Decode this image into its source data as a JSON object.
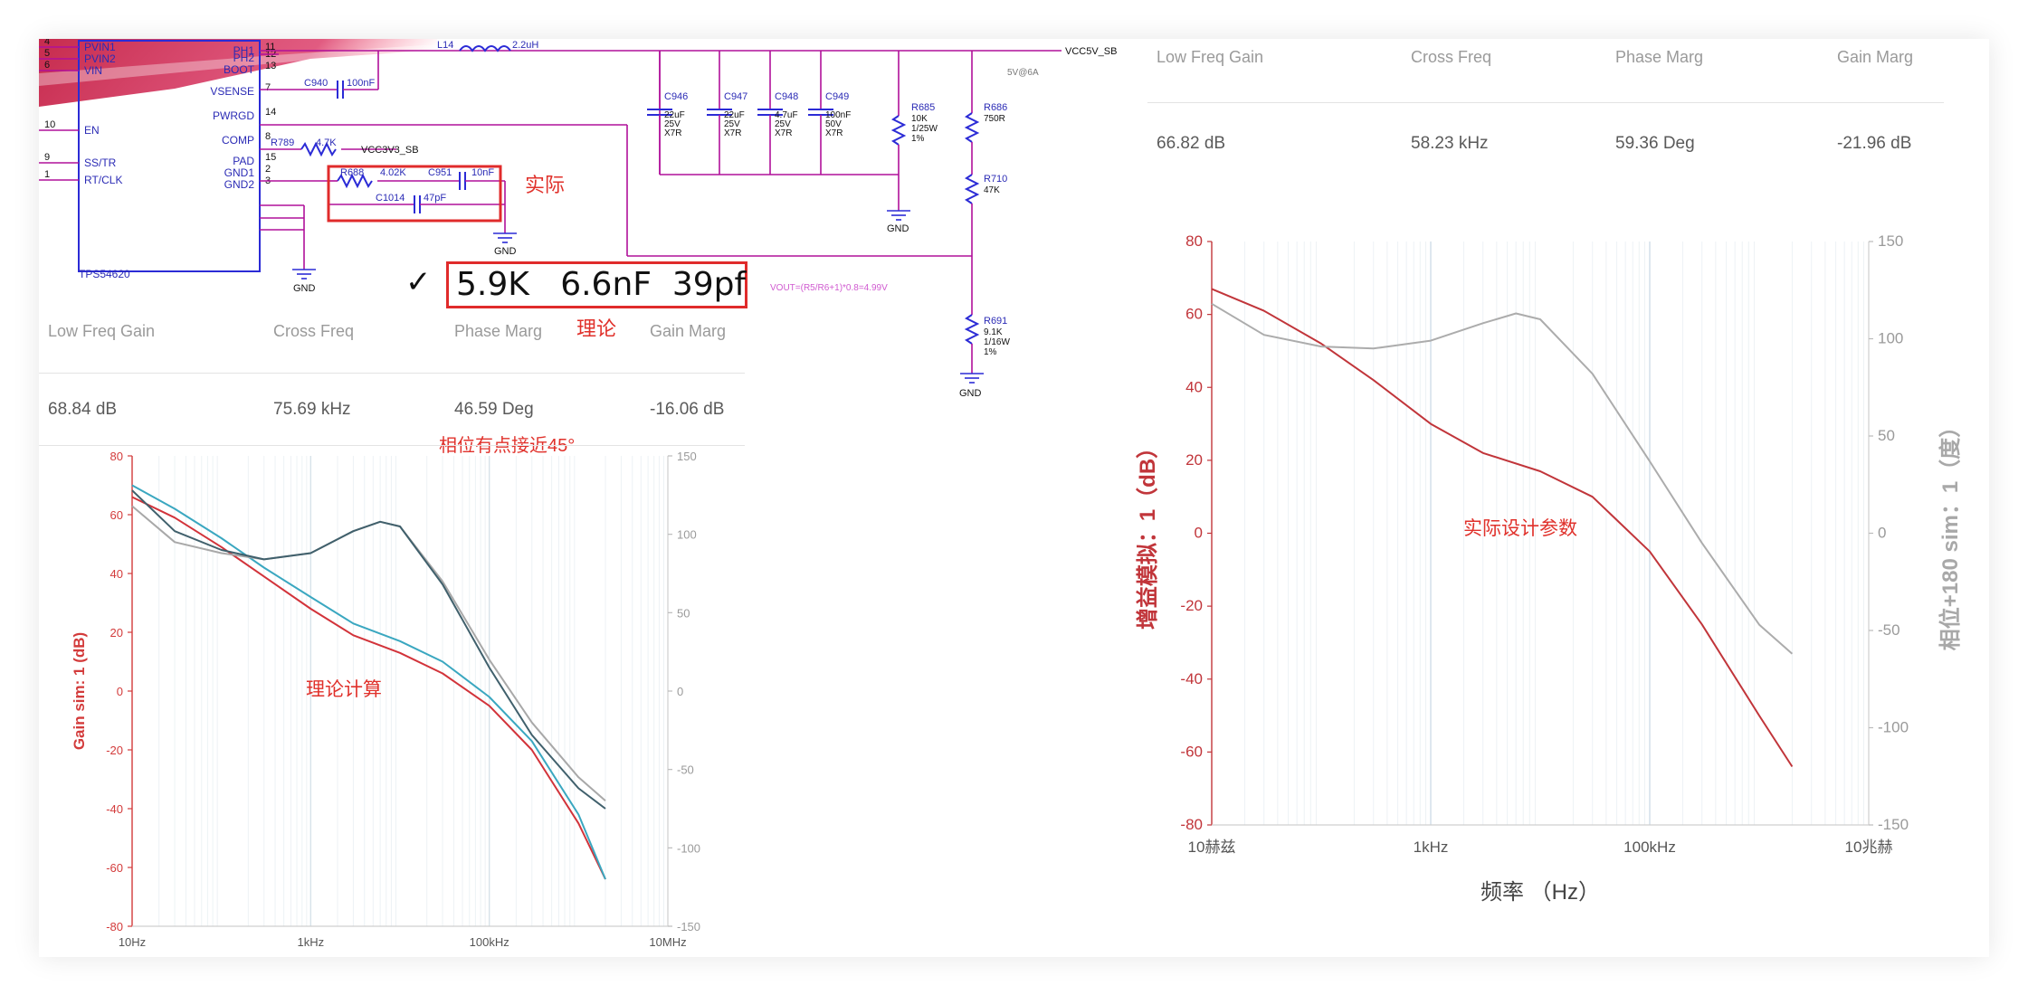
{
  "schematic": {
    "ic_name": "TPS54620",
    "pins_left": [
      {
        "num": "4",
        "name": "PVIN1"
      },
      {
        "num": "5",
        "name": "PVIN2"
      },
      {
        "num": "6",
        "name": "VIN"
      },
      {
        "num": "10",
        "name": "EN"
      },
      {
        "num": "9",
        "name": "SS/TR"
      },
      {
        "num": "1",
        "name": "RT/CLK"
      }
    ],
    "pins_right": [
      {
        "num": "11",
        "name": "PH1"
      },
      {
        "num": "12",
        "name": "PH2"
      },
      {
        "num": "13",
        "name": "BOOT"
      },
      {
        "num": "7",
        "name": "VSENSE"
      },
      {
        "num": "14",
        "name": "PWRGD"
      },
      {
        "num": "8",
        "name": "COMP"
      },
      {
        "num": "15",
        "name": "PAD"
      },
      {
        "num": "2",
        "name": "GND1"
      },
      {
        "num": "3",
        "name": "GND2"
      }
    ],
    "inductor": {
      "ref": "L14",
      "value": "2.2uH"
    },
    "c940": {
      "ref": "C940",
      "value": "100nF"
    },
    "r789": {
      "ref": "R789",
      "value": "4.7K"
    },
    "vcc3v3": "VCC3V3_SB",
    "vcc5v": "VCC5V_SB",
    "rail_note": "5V@6A",
    "r688": {
      "ref": "R688",
      "value": "4.02K"
    },
    "c951": {
      "ref": "C951",
      "value": "10nF"
    },
    "c1014": {
      "ref": "C1014",
      "value": "47pF"
    },
    "caps": [
      {
        "ref": "C946",
        "lines": [
          "22uF",
          "25V",
          "X7R"
        ]
      },
      {
        "ref": "C947",
        "lines": [
          "22uF",
          "25V",
          "X7R"
        ]
      },
      {
        "ref": "C948",
        "lines": [
          "4.7uF",
          "25V",
          "X7R"
        ]
      },
      {
        "ref": "C949",
        "lines": [
          "100nF",
          "50V",
          "X7R"
        ]
      }
    ],
    "r685": {
      "ref": "R685",
      "lines": [
        "10K",
        "1/25W",
        "1%"
      ]
    },
    "r686": {
      "ref": "R686",
      "lines": [
        "750R"
      ]
    },
    "r710": {
      "ref": "R710",
      "lines": [
        "47K"
      ]
    },
    "r691": {
      "ref": "R691",
      "lines": [
        "9.1K",
        "1/16W",
        "1%"
      ]
    },
    "gnd": "GND",
    "vout_formula": "VOUT=(R5/R6+1)*0.8=4.99V"
  },
  "annotations": {
    "actual": "实际",
    "check": "✓",
    "theory_values": "5.9K   6.6nF  39pf",
    "theory": "理论",
    "phase_note": "相位有点接近45°",
    "theory_calc": "理论计算",
    "actual_design": "实际设计参数"
  },
  "stats_left": {
    "headers": [
      "Low Freq Gain",
      "Cross Freq",
      "Phase Marg",
      "Gain Marg"
    ],
    "values": [
      "68.84 dB",
      "75.69 kHz",
      "46.59 Deg",
      "-16.06 dB"
    ]
  },
  "stats_right": {
    "headers": [
      "Low Freq Gain",
      "Cross Freq",
      "Phase Marg",
      "Gain Marg"
    ],
    "values": [
      "66.82 dB",
      "58.23 kHz",
      "59.36 Deg",
      "-21.96 dB"
    ]
  },
  "chart_data": [
    {
      "type": "line",
      "title": "",
      "xlabel": "",
      "ylabel": "Gain sim: 1 (dB)",
      "y2label": "",
      "x_scale": "log",
      "xlim": [
        10,
        10000000
      ],
      "ylim": [
        -80,
        80
      ],
      "y2lim": [
        -150,
        150
      ],
      "x_ticks": [
        {
          "v": 10,
          "label": "10Hz"
        },
        {
          "v": 1000,
          "label": "1kHz"
        },
        {
          "v": 100000,
          "label": "100kHz"
        },
        {
          "v": 10000000,
          "label": "10MHz"
        }
      ],
      "y_ticks": [
        "80",
        "60",
        "40",
        "20",
        "0",
        "-20",
        "-40",
        "-60",
        "-80"
      ],
      "y2_ticks": [
        "150",
        "100",
        "50",
        "0",
        "-50",
        "-100",
        "-150"
      ],
      "colors": {
        "gain": "#d2333a",
        "phase": "#a8a8a8",
        "teal": "#3aa7c0",
        "dark": "#40606c",
        "axis_left": "#d33b3b",
        "grid": "#d7e3ea"
      },
      "series": [
        {
          "axis": "left",
          "color": "#d2333a",
          "x": [
            10,
            30,
            100,
            300,
            1000,
            3000,
            10000,
            30000,
            100000,
            300000,
            1000000,
            2000000
          ],
          "y": [
            66,
            59,
            49,
            39,
            28,
            19,
            13,
            6,
            -5,
            -20,
            -45,
            -64
          ]
        },
        {
          "axis": "left",
          "color": "#3aa7c0",
          "x": [
            10,
            30,
            100,
            300,
            1000,
            3000,
            10000,
            30000,
            100000,
            300000,
            1000000,
            2000000
          ],
          "y": [
            70,
            62,
            52,
            42,
            32,
            23,
            17,
            10,
            -2,
            -17,
            -42,
            -64
          ]
        },
        {
          "axis": "right",
          "color": "#a8a8a8",
          "x": [
            10,
            30,
            100,
            300,
            1000,
            3000,
            6000,
            10000,
            30000,
            100000,
            300000,
            1000000,
            2000000
          ],
          "y": [
            118,
            95,
            88,
            84,
            88,
            102,
            108,
            105,
            70,
            20,
            -20,
            -55,
            -70
          ]
        },
        {
          "axis": "right",
          "color": "#40606c",
          "x": [
            10,
            30,
            100,
            300,
            1000,
            3000,
            6000,
            10000,
            30000,
            100000,
            300000,
            1000000,
            2000000
          ],
          "y": [
            128,
            102,
            90,
            84,
            88,
            102,
            108,
            105,
            68,
            15,
            -28,
            -62,
            -75
          ]
        }
      ]
    },
    {
      "type": "line",
      "title": "",
      "xlabel": "频率 （Hz）",
      "ylabel": "增益模拟：1（dB）",
      "y2label": "相位+180 sim：1（度）",
      "x_scale": "log",
      "xlim": [
        10,
        10000000
      ],
      "ylim": [
        -80,
        80
      ],
      "y2lim": [
        -150,
        150
      ],
      "x_ticks": [
        {
          "v": 10,
          "label": "10赫兹"
        },
        {
          "v": 1000,
          "label": "1kHz"
        },
        {
          "v": 100000,
          "label": "100kHz"
        },
        {
          "v": 10000000,
          "label": "10兆赫"
        }
      ],
      "y_ticks": [
        "80",
        "60",
        "40",
        "20",
        "0",
        "-20",
        "-40",
        "-60",
        "-80"
      ],
      "y2_ticks": [
        "150",
        "100",
        "50",
        "0",
        "-50",
        "-100",
        "-150"
      ],
      "colors": {
        "gain": "#c1353a",
        "phase": "#acacac",
        "axis_left": "#c1353a",
        "grid": "#cfdde8"
      },
      "series": [
        {
          "axis": "left",
          "color": "#c1353a",
          "x": [
            10,
            30,
            100,
            300,
            1000,
            3000,
            10000,
            30000,
            100000,
            300000,
            1000000,
            2000000
          ],
          "y": [
            67,
            61,
            52,
            42,
            30,
            22,
            17,
            10,
            -5,
            -25,
            -50,
            -64
          ]
        },
        {
          "axis": "right",
          "color": "#acacac",
          "x": [
            10,
            30,
            100,
            300,
            1000,
            3000,
            6000,
            10000,
            30000,
            100000,
            300000,
            1000000,
            2000000
          ],
          "y": [
            118,
            102,
            96,
            95,
            99,
            108,
            113,
            110,
            82,
            37,
            -5,
            -47,
            -62
          ]
        }
      ]
    }
  ]
}
